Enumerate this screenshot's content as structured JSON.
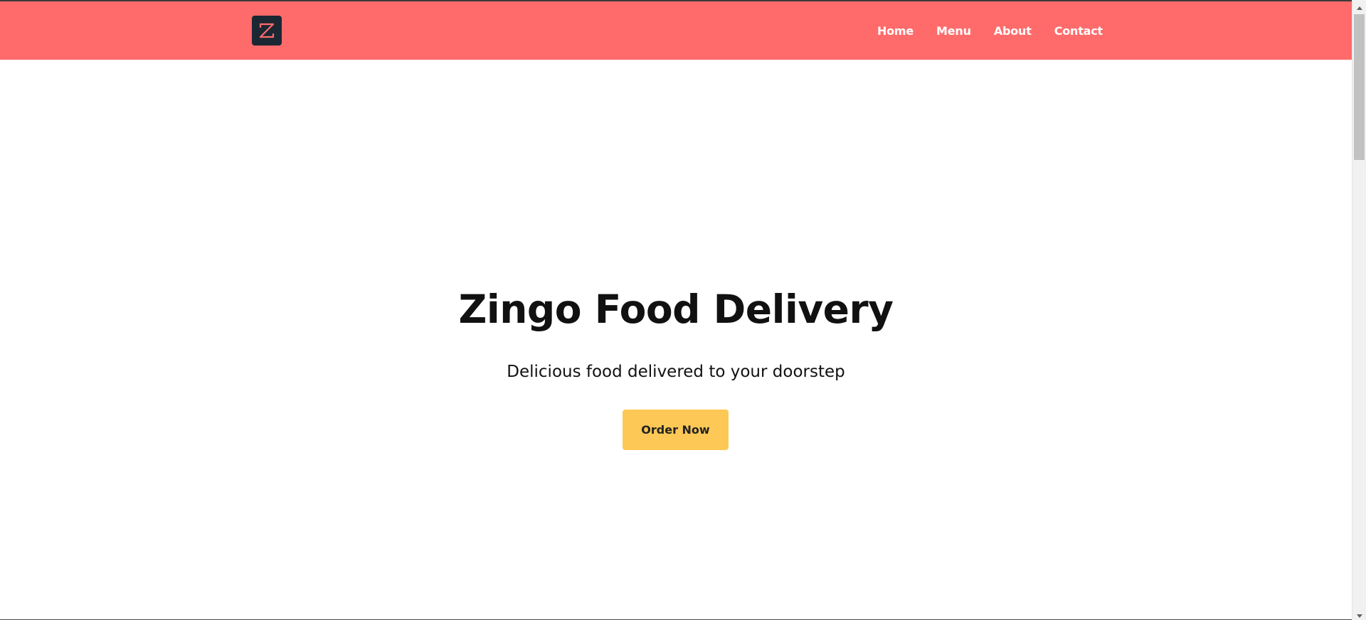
{
  "brand": {
    "logo_icon": "z-logo-icon",
    "logo_letter": "Z",
    "colors": {
      "navbar": "#ff6b6b",
      "logo_bg": "#1b2733",
      "logo_mark": "#ff6b6b",
      "cta": "#fec856"
    }
  },
  "nav": {
    "items": [
      {
        "label": "Home"
      },
      {
        "label": "Menu"
      },
      {
        "label": "About"
      },
      {
        "label": "Contact"
      }
    ]
  },
  "hero": {
    "title": "Zingo Food Delivery",
    "subtitle": "Delicious food delivered to your doorstep",
    "cta_label": "Order Now"
  },
  "scrollbar": {
    "up_icon": "arrow-up-icon",
    "down_icon": "arrow-down-icon"
  }
}
